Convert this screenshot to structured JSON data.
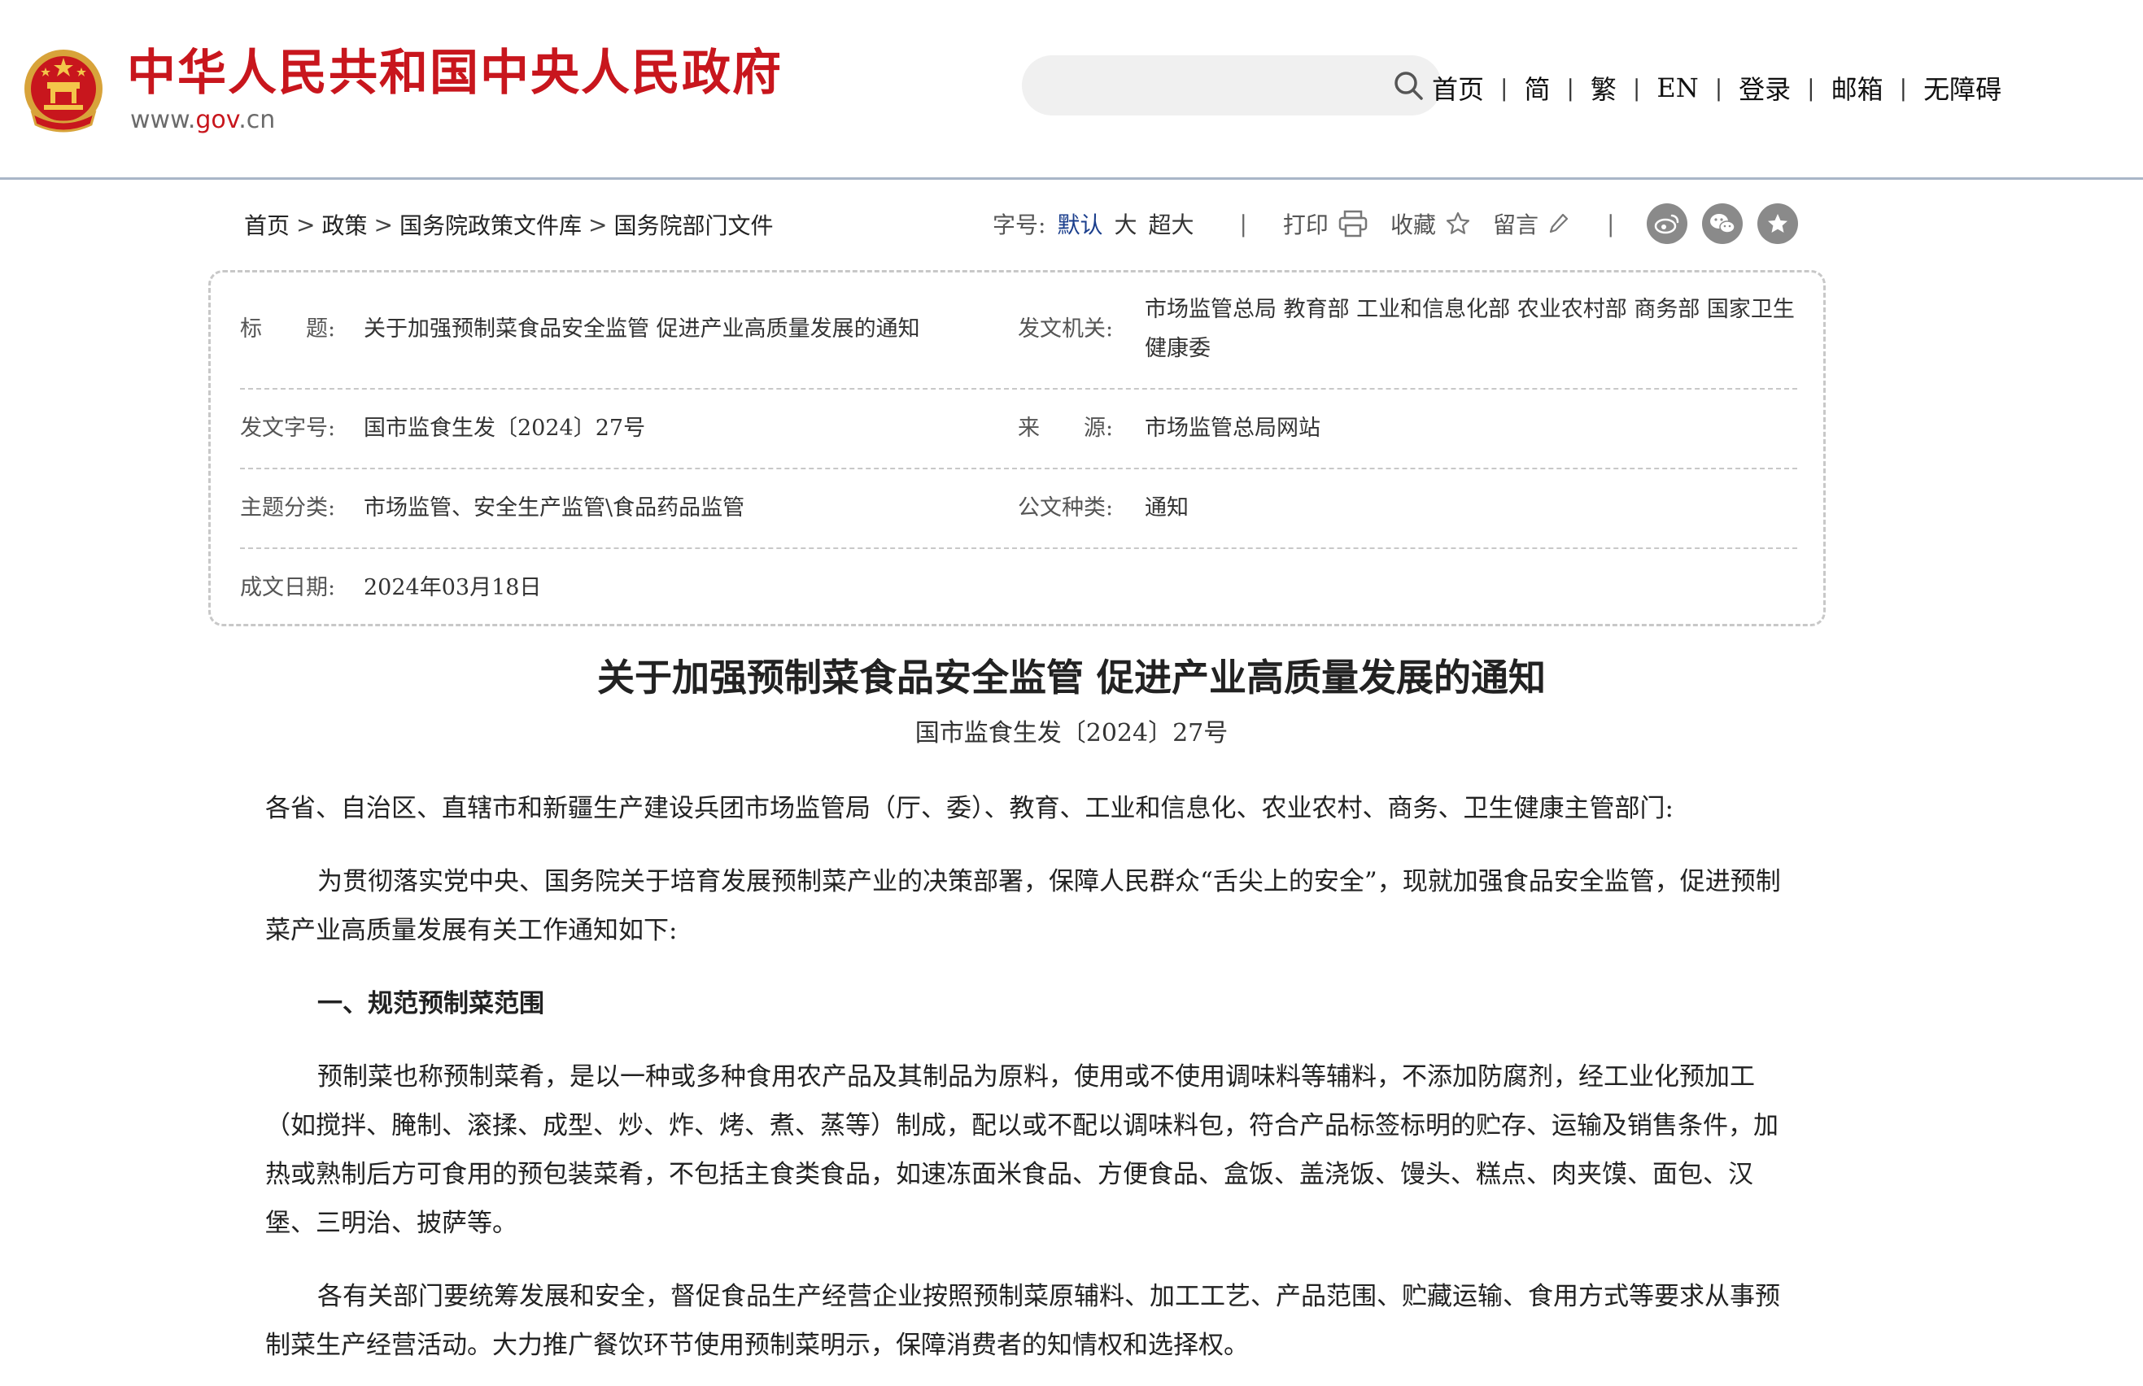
{
  "header": {
    "site_name": "中华人民共和国中央人民政府",
    "domain_prefix": "www.",
    "domain_gov": "gov",
    "domain_suffix": ".cn",
    "search_placeholder": "",
    "nav": [
      "首页",
      "简",
      "繁",
      "EN",
      "登录",
      "邮箱",
      "无障碍"
    ],
    "nav_separator": "|"
  },
  "breadcrumb": {
    "items": [
      "首页",
      "政策",
      "国务院政策文件库",
      "国务院部门文件"
    ],
    "separator": ">"
  },
  "toolbar": {
    "font_size_label": "字号:",
    "font_size_options": [
      "默认",
      "大",
      "超大"
    ],
    "print_label": "打印",
    "favorite_label": "收藏",
    "comment_label": "留言",
    "separator": "|",
    "share_icons": [
      "weibo-icon",
      "wechat-icon",
      "star-share-icon"
    ]
  },
  "info": {
    "title_label": "标　　题:",
    "title_value": "关于加强预制菜食品安全监管 促进产业高质量发展的通知",
    "issuer_label": "发文机关:",
    "issuer_value": "市场监管总局 教育部 工业和信息化部 农业农村部 商务部 国家卫生健康委",
    "doc_no_label": "发文字号:",
    "doc_no_value": "国市监食生发〔2024〕27号",
    "source_label": "来　　源:",
    "source_value": "市场监管总局网站",
    "topic_label": "主题分类:",
    "topic_value": "市场监管、安全生产监管\\食品药品监管",
    "doc_type_label": "公文种类:",
    "doc_type_value": "通知",
    "date_label": "成文日期:",
    "date_value": "2024年03月18日"
  },
  "article": {
    "title": "关于加强预制菜食品安全监管 促进产业高质量发展的通知",
    "doc_number": "国市监食生发〔2024〕27号",
    "addressee": "各省、自治区、直辖市和新疆生产建设兵团市场监管局（厅、委）、教育、工业和信息化、农业农村、商务、卫生健康主管部门:",
    "para1": "为贯彻落实党中央、国务院关于培育发展预制菜产业的决策部署，保障人民群众“舌尖上的安全”，现就加强食品安全监管，促进预制菜产业高质量发展有关工作通知如下:",
    "section1": "一、规范预制菜范围",
    "para2": "预制菜也称预制菜肴，是以一种或多种食用农产品及其制品为原料，使用或不使用调味料等辅料，不添加防腐剂，经工业化预加工（如搅拌、腌制、滚揉、成型、炒、炸、烤、煮、蒸等）制成，配以或不配以调味料包，符合产品标签标明的贮存、运输及销售条件，加热或熟制后方可食用的预包装菜肴，不包括主食类食品，如速冻面米食品、方便食品、盒饭、盖浇饭、馒头、糕点、肉夹馍、面包、汉堡、三明治、披萨等。",
    "para3": "各有关部门要统筹发展和安全，督促食品生产经营企业按照预制菜原辅料、加工工艺、产品范围、贮藏运输、食用方式等要求从事预制菜生产经营活动。大力推广餐饮环节使用预制菜明示，保障消费者的知情权和选择权。"
  },
  "colors": {
    "brand_red": "#c8161d",
    "link_blue": "#1a3e8c",
    "header_rule": "#a9b6c8",
    "dashed_border": "#c8c8c8"
  }
}
